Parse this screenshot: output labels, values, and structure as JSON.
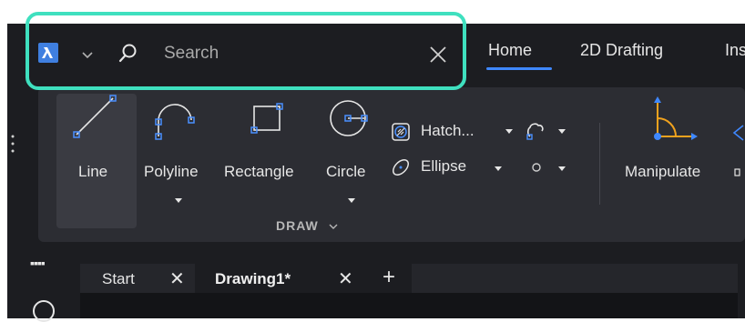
{
  "search": {
    "placeholder": "Search"
  },
  "ribbon_tabs": [
    {
      "label": "Home",
      "active": true
    },
    {
      "label": "2D Drafting"
    },
    {
      "label": "Ins"
    }
  ],
  "draw_tools": {
    "line": "Line",
    "polyline": "Polyline",
    "rectangle": "Rectangle",
    "circle": "Circle",
    "hatch": "Hatch...",
    "ellipse": "Ellipse",
    "manipulate": "Manipulate"
  },
  "group_label": "DRAW",
  "doc_tabs": [
    {
      "label": "Start"
    },
    {
      "label": "Drawing1*",
      "active": true
    }
  ],
  "colors": {
    "highlight": "#3fe0bf",
    "accent": "#3f7fe0",
    "ribbon_bg": "#2c2d33",
    "app_bg": "#1c1d21"
  },
  "icons": [
    "app-logo-icon",
    "chevron-down-icon",
    "search-icon",
    "close-icon",
    "line-icon",
    "polyline-icon",
    "rectangle-icon",
    "circle-icon",
    "hatch-icon",
    "ellipse-icon",
    "revcloud-icon",
    "point-icon",
    "manipulate-icon",
    "plus-icon"
  ]
}
